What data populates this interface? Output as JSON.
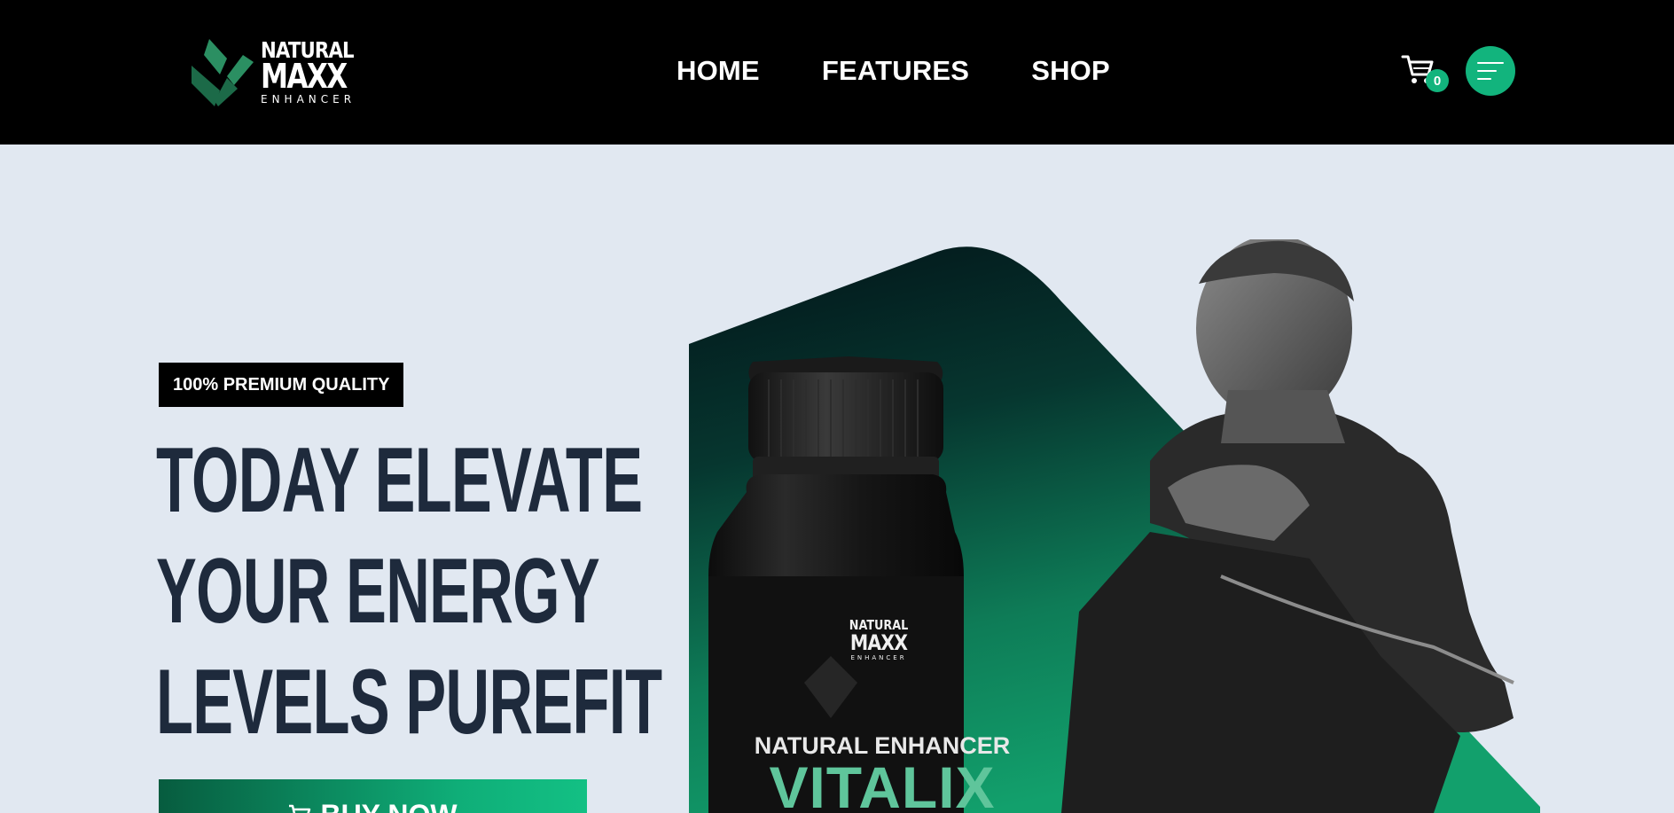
{
  "brand": {
    "logo_top": "NATURAL",
    "logo_mid": "MAXX",
    "logo_bottom": "ENHANCER"
  },
  "nav": {
    "items": [
      {
        "label": "HOME"
      },
      {
        "label": "FEATURES"
      },
      {
        "label": "SHOP"
      }
    ]
  },
  "cart": {
    "count": "0",
    "icon": "cart-icon"
  },
  "menu": {
    "icon": "hamburger-menu-icon"
  },
  "hero": {
    "badge": "100% PREMIUM QUALITY",
    "headline": [
      "TODAY ELEVATE",
      "YOUR ENERGY",
      "LEVELS PUREFIT"
    ],
    "cta_label": "BUY NOW",
    "cta_icon": "cart-icon"
  },
  "product": {
    "brand_top": "NATURAL",
    "brand_mid": "MAXX",
    "brand_bottom": "ENHANCER",
    "subtitle": "NATURAL ENHANCER",
    "name": "VITALIX"
  },
  "colors": {
    "accent": "#12b47d",
    "header_bg": "#000000",
    "page_bg": "#e1e8f1",
    "headline": "#1e2a3c"
  }
}
